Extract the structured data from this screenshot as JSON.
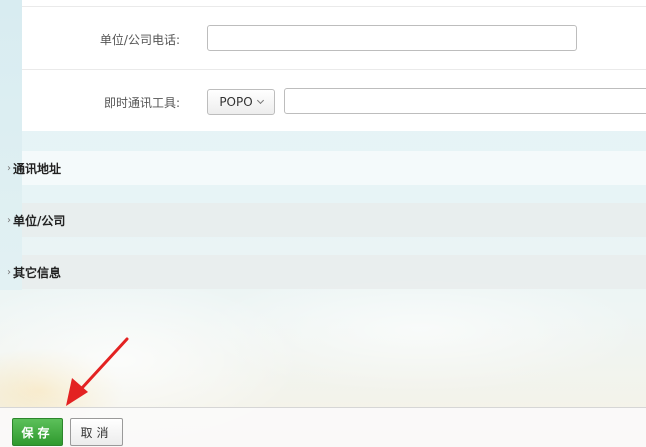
{
  "form": {
    "phone_label": "单位/公司电话:",
    "phone_value": "",
    "im_label": "即时通讯工具:",
    "im_type": "POPO",
    "im_value": ""
  },
  "sections": [
    {
      "title": "通讯地址",
      "caret": "›"
    },
    {
      "title": "单位/公司",
      "caret": "›"
    },
    {
      "title": "其它信息",
      "caret": "›"
    }
  ],
  "footer": {
    "save_label": "保存",
    "cancel_label": "取消"
  },
  "colors": {
    "save_button": "#3aa838",
    "annotation_arrow": "#e32222"
  },
  "icons": {
    "select_chevron": "chevron-down-icon",
    "section_caret": "chevron-right-icon",
    "annotation": "red-arrow-icon"
  }
}
